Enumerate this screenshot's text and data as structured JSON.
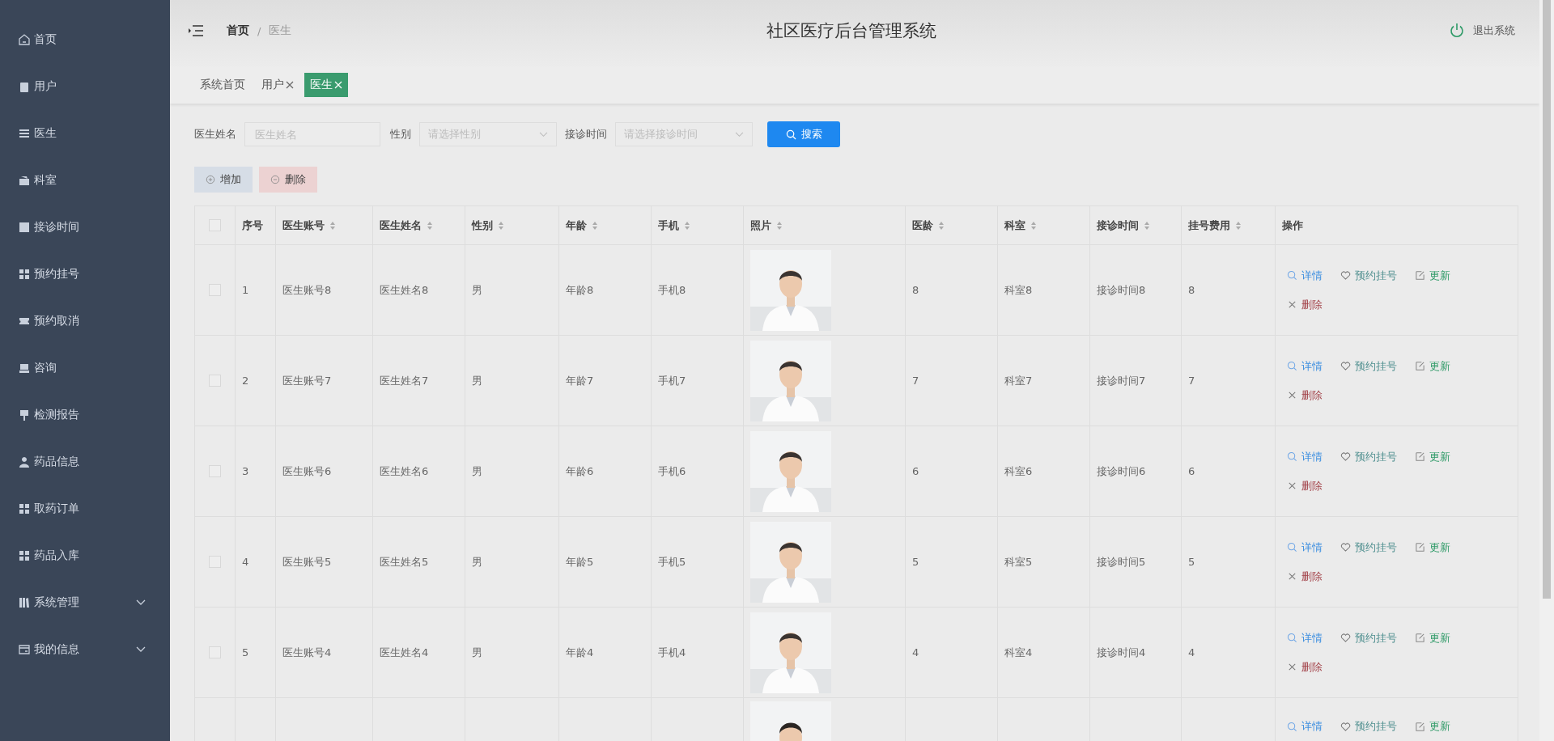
{
  "sidebar": {
    "items": [
      {
        "label": "首页",
        "expandable": false
      },
      {
        "label": "用户",
        "expandable": false
      },
      {
        "label": "医生",
        "expandable": false
      },
      {
        "label": "科室",
        "expandable": false
      },
      {
        "label": "接诊时间",
        "expandable": false
      },
      {
        "label": "预约挂号",
        "expandable": false
      },
      {
        "label": "预约取消",
        "expandable": false
      },
      {
        "label": "咨询",
        "expandable": false
      },
      {
        "label": "检测报告",
        "expandable": false
      },
      {
        "label": "药品信息",
        "expandable": false
      },
      {
        "label": "取药订单",
        "expandable": false
      },
      {
        "label": "药品入库",
        "expandable": false
      },
      {
        "label": "系统管理",
        "expandable": true
      },
      {
        "label": "我的信息",
        "expandable": true
      }
    ]
  },
  "header": {
    "breadcrumb": [
      "首页",
      "医生"
    ],
    "breadcrumb_separator": "/",
    "title": "社区医疗后台管理系统",
    "logout": "退出系统"
  },
  "tabs": [
    {
      "label": "系统首页",
      "closable": false,
      "selected": false
    },
    {
      "label": "用户",
      "closable": true,
      "selected": false
    },
    {
      "label": "医生",
      "closable": true,
      "selected": true
    }
  ],
  "filters": [
    {
      "kind": "input",
      "label": "医生姓名",
      "placeholder": "医生姓名"
    },
    {
      "kind": "select",
      "label": "性别",
      "placeholder": "请选择性别"
    },
    {
      "kind": "select",
      "label": "接诊时间",
      "placeholder": "请选择接诊时间"
    }
  ],
  "search_button": "搜索",
  "toolbar": [
    {
      "kind": "add",
      "label": "增加"
    },
    {
      "kind": "delete",
      "label": "删除"
    }
  ],
  "table": {
    "select_all_checked": false,
    "columns": [
      {
        "label": "序号",
        "sortable": false
      },
      {
        "label": "医生账号",
        "sortable": true
      },
      {
        "label": "医生姓名",
        "sortable": true
      },
      {
        "label": "性别",
        "sortable": true
      },
      {
        "label": "年龄",
        "sortable": true
      },
      {
        "label": "手机",
        "sortable": true
      },
      {
        "label": "照片",
        "sortable": true
      },
      {
        "label": "医龄",
        "sortable": true
      },
      {
        "label": "科室",
        "sortable": true
      },
      {
        "label": "接诊时间",
        "sortable": true
      },
      {
        "label": "挂号费用",
        "sortable": true
      },
      {
        "label": "操作",
        "sortable": false
      }
    ],
    "rows": [
      {
        "checked": false,
        "cells": [
          "1",
          "医生账号8",
          "医生姓名8",
          "男",
          "年龄8",
          "手机8"
        ],
        "photo": {
          "kind": "picture"
        },
        "cells_after": [
          "8",
          "科室8",
          "接诊时间8",
          "8"
        ],
        "actions": [
          {
            "kind": "detail",
            "label": "详情"
          },
          {
            "kind": "book",
            "label": "预约挂号"
          },
          {
            "kind": "update",
            "label": "更新"
          },
          {
            "kind": "delete",
            "label": "删除"
          }
        ]
      },
      {
        "checked": false,
        "cells": [
          "2",
          "医生账号7",
          "医生姓名7",
          "男",
          "年龄7",
          "手机7"
        ],
        "photo": {
          "kind": "picture"
        },
        "cells_after": [
          "7",
          "科室7",
          "接诊时间7",
          "7"
        ],
        "actions": [
          {
            "kind": "detail",
            "label": "详情"
          },
          {
            "kind": "book",
            "label": "预约挂号"
          },
          {
            "kind": "update",
            "label": "更新"
          },
          {
            "kind": "delete",
            "label": "删除"
          }
        ]
      },
      {
        "checked": false,
        "cells": [
          "3",
          "医生账号6",
          "医生姓名6",
          "男",
          "年龄6",
          "手机6"
        ],
        "photo": {
          "kind": "picture"
        },
        "cells_after": [
          "6",
          "科室6",
          "接诊时间6",
          "6"
        ],
        "actions": [
          {
            "kind": "detail",
            "label": "详情"
          },
          {
            "kind": "book",
            "label": "预约挂号"
          },
          {
            "kind": "update",
            "label": "更新"
          },
          {
            "kind": "delete",
            "label": "删除"
          }
        ]
      },
      {
        "checked": false,
        "cells": [
          "4",
          "医生账号5",
          "医生姓名5",
          "男",
          "年龄5",
          "手机5"
        ],
        "photo": {
          "kind": "picture"
        },
        "cells_after": [
          "5",
          "科室5",
          "接诊时间5",
          "5"
        ],
        "actions": [
          {
            "kind": "detail",
            "label": "详情"
          },
          {
            "kind": "book",
            "label": "预约挂号"
          },
          {
            "kind": "update",
            "label": "更新"
          },
          {
            "kind": "delete",
            "label": "删除"
          }
        ]
      },
      {
        "checked": false,
        "cells": [
          "5",
          "医生账号4",
          "医生姓名4",
          "男",
          "年龄4",
          "手机4"
        ],
        "photo": {
          "kind": "picture"
        },
        "cells_after": [
          "4",
          "科室4",
          "接诊时间4",
          "4"
        ],
        "actions": [
          {
            "kind": "detail",
            "label": "详情"
          },
          {
            "kind": "book",
            "label": "预约挂号"
          },
          {
            "kind": "update",
            "label": "更新"
          },
          {
            "kind": "delete",
            "label": "删除"
          }
        ]
      }
    ],
    "partial_row": {
      "photo": {
        "kind": "picture"
      },
      "actions": [
        {
          "kind": "detail",
          "label": "详情"
        },
        {
          "kind": "book",
          "label": "预约挂号"
        },
        {
          "kind": "update",
          "label": "更新"
        }
      ]
    }
  }
}
